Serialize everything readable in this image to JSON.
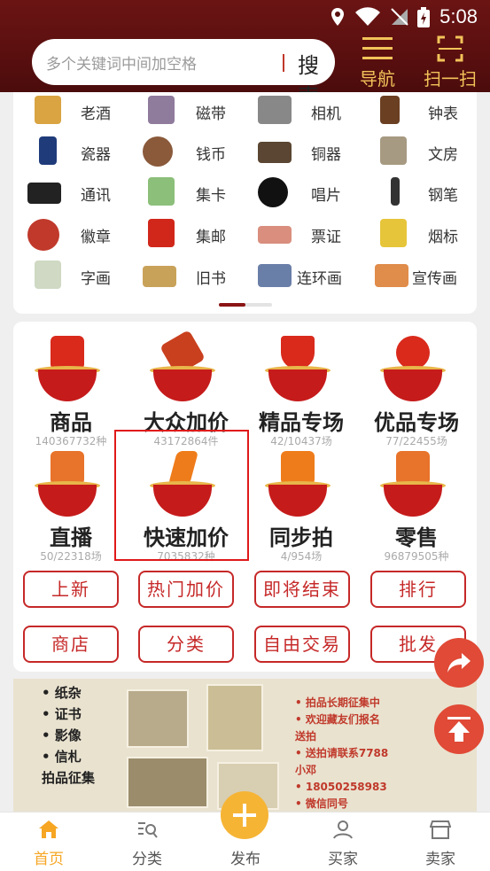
{
  "status": {
    "time": "5:08"
  },
  "search": {
    "placeholder": "多个关键词中间加空格",
    "button": "搜索"
  },
  "header": {
    "nav_label": "导航",
    "scan_label": "扫一扫"
  },
  "categories": [
    "老酒",
    "磁带",
    "相机",
    "钟表",
    "瓷器",
    "钱币",
    "铜器",
    "文房",
    "通讯",
    "集卡",
    "唱片",
    "钢笔",
    "徽章",
    "集邮",
    "票证",
    "烟标",
    "字画",
    "旧书",
    "连环画",
    "宣传画"
  ],
  "features": [
    {
      "label": "商品",
      "count": "140367732种"
    },
    {
      "label": "大众加价",
      "count": "43172864件"
    },
    {
      "label": "精品专场",
      "count": "42/10437场"
    },
    {
      "label": "优品专场",
      "count": "77/22455场"
    },
    {
      "label": "直播",
      "count": "50/22318场"
    },
    {
      "label": "快速加价",
      "count": "7035832种"
    },
    {
      "label": "同步拍",
      "count": "4/954场"
    },
    {
      "label": "零售",
      "count": "96879505种"
    }
  ],
  "buttons": [
    "上新",
    "热门加价",
    "即将结束",
    "排行",
    "商店",
    "分类",
    "自由交易",
    "批发"
  ],
  "banner": {
    "left": [
      "• 纸杂",
      "• 证书",
      "• 影像",
      "• 信札",
      "拍品征集"
    ],
    "right": [
      "• 拍品长期征集中",
      "• 欢迎藏友们报名",
      "  送拍",
      "• 送拍请联系7788",
      "  小邓",
      "• 18050258983",
      "• 微信同号"
    ]
  },
  "bottom_nav": [
    "首页",
    "分类",
    "发布",
    "买家",
    "卖家"
  ],
  "colors": {
    "header": "#5a0f0f",
    "accent": "#c62828",
    "gold": "#f2c35a",
    "home_active": "#f6a623"
  }
}
